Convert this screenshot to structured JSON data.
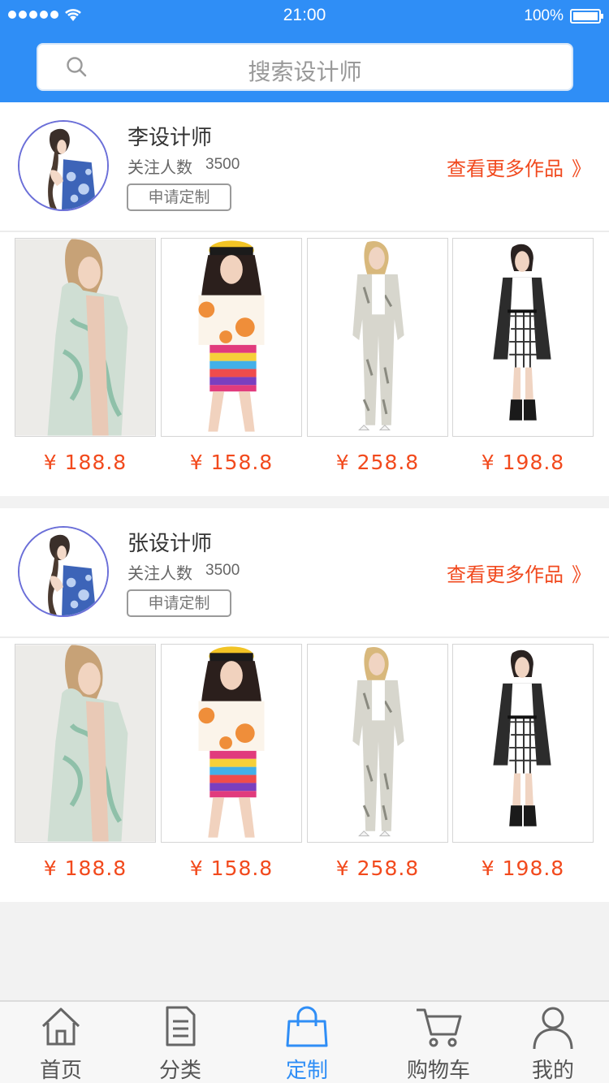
{
  "status_bar": {
    "time": "21:00",
    "battery": "100%"
  },
  "search": {
    "placeholder": "搜索设计师"
  },
  "designers": [
    {
      "name": "李设计师",
      "follow_label": "关注人数",
      "follow_count": "3500",
      "apply_label": "申请定制",
      "more_label": "查看更多作品",
      "more_icon": "》",
      "products": [
        {
          "price": "¥ 188.8"
        },
        {
          "price": "¥ 158.8"
        },
        {
          "price": "¥ 258.8"
        },
        {
          "price": "¥ 198.8"
        }
      ]
    },
    {
      "name": "张设计师",
      "follow_label": "关注人数",
      "follow_count": "3500",
      "apply_label": "申请定制",
      "more_label": "查看更多作品",
      "more_icon": "》",
      "products": [
        {
          "price": "¥ 188.8"
        },
        {
          "price": "¥ 158.8"
        },
        {
          "price": "¥ 258.8"
        },
        {
          "price": "¥ 198.8"
        }
      ]
    }
  ],
  "tabbar": {
    "items": [
      {
        "label": "首页",
        "icon": "home-icon"
      },
      {
        "label": "分类",
        "icon": "document-icon"
      },
      {
        "label": "定制",
        "icon": "bag-icon",
        "active": true
      },
      {
        "label": "购物车",
        "icon": "cart-icon"
      },
      {
        "label": "我的",
        "icon": "user-icon"
      }
    ]
  },
  "colors": {
    "primary": "#2f8ef6",
    "price": "#f24a1d",
    "link": "#f14a1f"
  }
}
